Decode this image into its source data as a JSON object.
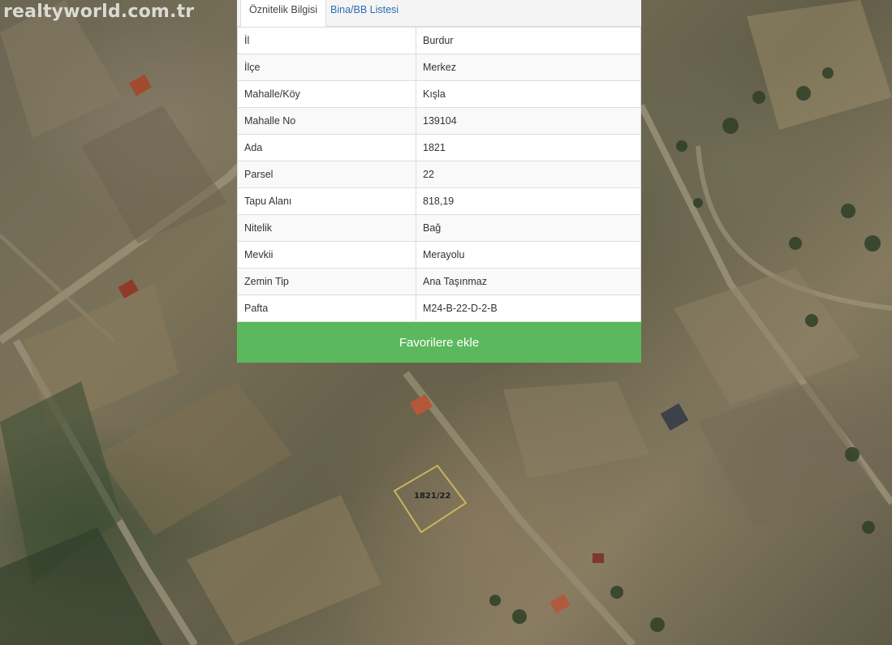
{
  "watermark": "realtyworld.com.tr",
  "tabs": [
    {
      "label": "Öznitelik Bilgisi",
      "active": true
    },
    {
      "label": "Bina/BB Listesi",
      "active": false
    }
  ],
  "attributes": [
    {
      "key": "İl",
      "value": "Burdur"
    },
    {
      "key": "İlçe",
      "value": "Merkez"
    },
    {
      "key": "Mahalle/Köy",
      "value": "Kışla"
    },
    {
      "key": "Mahalle No",
      "value": "139104"
    },
    {
      "key": "Ada",
      "value": "1821"
    },
    {
      "key": "Parsel",
      "value": "22"
    },
    {
      "key": "Tapu Alanı",
      "value": "818,19"
    },
    {
      "key": "Nitelik",
      "value": "Bağ"
    },
    {
      "key": "Mevkii",
      "value": "Merayolu"
    },
    {
      "key": "Zemin Tip",
      "value": "Ana Taşınmaz"
    },
    {
      "key": "Pafta",
      "value": "M24-B-22-D-2-B"
    }
  ],
  "favorite_button": "Favorilere ekle",
  "map": {
    "parcel_label": "1821/22"
  },
  "colors": {
    "button": "#5cb85c",
    "tab_link": "#2a6fb4",
    "parcel_outline": "#c8b560"
  }
}
